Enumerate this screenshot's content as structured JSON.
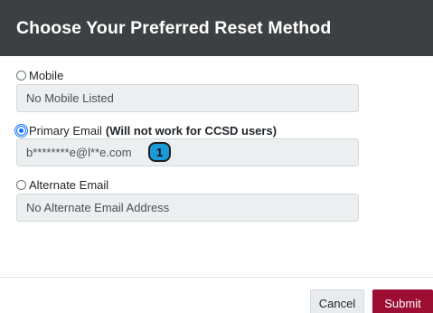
{
  "dialog": {
    "title": "Choose Your Preferred Reset Method"
  },
  "options": {
    "mobile": {
      "label": "Mobile",
      "value": "No Mobile Listed",
      "selected": false
    },
    "primary_email": {
      "label": "Primary Email",
      "note": "(Will not work for CCSD users)",
      "value": "b********e@l**e.com",
      "selected": true
    },
    "alternate_email": {
      "label": "Alternate Email",
      "value": "No Alternate Email Address",
      "selected": false
    }
  },
  "annotation": {
    "badge": "1"
  },
  "footer": {
    "cancel_label": "Cancel",
    "submit_label": "Submit"
  },
  "colors": {
    "header_bg": "#3d4042",
    "submit_bg": "#9b0e32",
    "badge_bg": "#1a9ad6"
  }
}
